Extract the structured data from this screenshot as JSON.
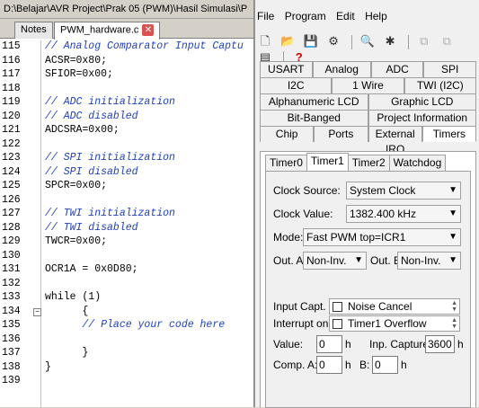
{
  "editor": {
    "title": "D:\\Belajar\\AVR Project\\Prak 05 (PWM)\\Hasil Simulasi\\P",
    "tabs": [
      {
        "label": "Notes"
      },
      {
        "label": "PWM_hardware.c"
      }
    ],
    "lines": [
      {
        "n": "115",
        "t": "// Analog Comparator Input Captu",
        "c": true
      },
      {
        "n": "116",
        "t": "ACSR=0x80;",
        "c": false
      },
      {
        "n": "117",
        "t": "SFIOR=0x00;",
        "c": false
      },
      {
        "n": "118",
        "t": "",
        "c": false
      },
      {
        "n": "119",
        "t": "// ADC initialization",
        "c": true
      },
      {
        "n": "120",
        "t": "// ADC disabled",
        "c": true
      },
      {
        "n": "121",
        "t": "ADCSRA=0x00;",
        "c": false
      },
      {
        "n": "122",
        "t": "",
        "c": false
      },
      {
        "n": "123",
        "t": "// SPI initialization",
        "c": true
      },
      {
        "n": "124",
        "t": "// SPI disabled",
        "c": true
      },
      {
        "n": "125",
        "t": "SPCR=0x00;",
        "c": false
      },
      {
        "n": "126",
        "t": "",
        "c": false
      },
      {
        "n": "127",
        "t": "// TWI initialization",
        "c": true
      },
      {
        "n": "128",
        "t": "// TWI disabled",
        "c": true
      },
      {
        "n": "129",
        "t": "TWCR=0x00;",
        "c": false
      },
      {
        "n": "130",
        "t": "",
        "c": false
      },
      {
        "n": "131",
        "t": "OCR1A = 0x0D80;",
        "c": false
      },
      {
        "n": "132",
        "t": "",
        "c": false
      },
      {
        "n": "133",
        "t": "while (1)",
        "c": false
      },
      {
        "n": "134",
        "t": "      {",
        "c": false
      },
      {
        "n": "135",
        "t": "      // Place your code here",
        "c": true
      },
      {
        "n": "136",
        "t": "",
        "c": false
      },
      {
        "n": "137",
        "t": "      }",
        "c": false
      },
      {
        "n": "138",
        "t": "}",
        "c": false
      },
      {
        "n": "139",
        "t": "",
        "c": false
      }
    ]
  },
  "wizard": {
    "menu": [
      "File",
      "Program",
      "Edit",
      "Help"
    ],
    "tab_rows": [
      [
        "USART",
        "Analog Comparator",
        "ADC",
        "SPI"
      ],
      [
        "I2C",
        "1 Wire",
        "TWI (I2C)"
      ],
      [
        "Alphanumeric LCD",
        "Graphic LCD"
      ],
      [
        "Bit-Banged",
        "Project Information"
      ],
      [
        "Chip",
        "Ports",
        "External IRQ",
        "Timers"
      ]
    ],
    "subtabs": [
      "Timer0",
      "Timer1",
      "Timer2",
      "Watchdog"
    ],
    "clock_source_label": "Clock Source:",
    "clock_source": "System Clock",
    "clock_value_label": "Clock Value:",
    "clock_value": "1382.400 kHz",
    "mode_label": "Mode:",
    "mode": "Fast PWM top=ICR1",
    "out_a_label": "Out. A:",
    "out_a": "Non-Inv.",
    "out_b_label": "Out. B:",
    "out_b": "Non-Inv.",
    "input_capt_label": "Input Capt. :",
    "noise_cancel": "Noise Cancel",
    "interrupt_label": "Interrupt on:",
    "timer1_overflow": "Timer1 Overflow",
    "value_label": "Value:",
    "value": "0",
    "inp_capture_label": "Inp. Capture:",
    "inp_capture": "3600",
    "comp_a_label": "Comp. A:",
    "comp_a": "0",
    "b_label": "B:",
    "b_value": "0",
    "unit_h": "h"
  }
}
